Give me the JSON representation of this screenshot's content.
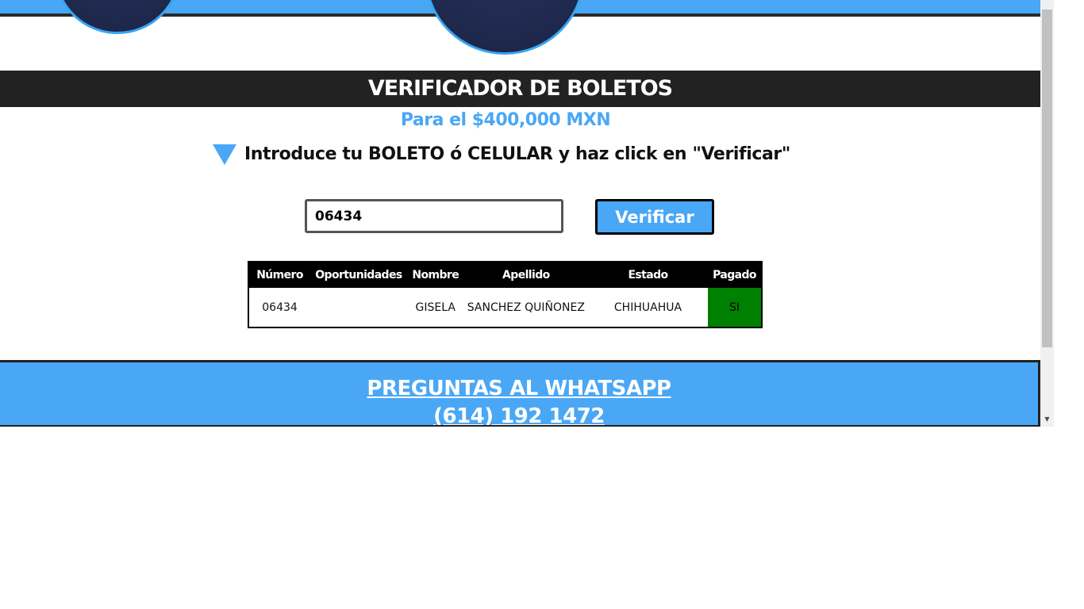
{
  "page": {
    "title": "VERIFICADOR DE BOLETOS",
    "subtitle": "Para el $400,000 MXN",
    "instruction": "Introduce tu BOLETO ó CELULAR y haz click en \"Verificar\""
  },
  "search": {
    "value": "06434",
    "button_label": "Verificar"
  },
  "table": {
    "headers": [
      "Número",
      "Oportunidades",
      "Nombre",
      "Apellido",
      "Estado",
      "Pagado"
    ],
    "rows": [
      {
        "numero": "06434",
        "oportunidades": "",
        "nombre": "GISELA",
        "apellido": "SANCHEZ QUIÑONEZ",
        "estado": "CHIHUAHUA",
        "pagado": "SI"
      }
    ]
  },
  "footer": {
    "whatsapp_label": "PREGUNTAS AL WHATSAPP",
    "phone": "(614) 192 1472"
  },
  "colors": {
    "accent": "#4aa7f6",
    "title_bar": "#222222",
    "paid": "#008000"
  },
  "icons": {
    "instruction": "triangle-down-icon",
    "scroll_down": "scroll-down-arrow-icon"
  }
}
